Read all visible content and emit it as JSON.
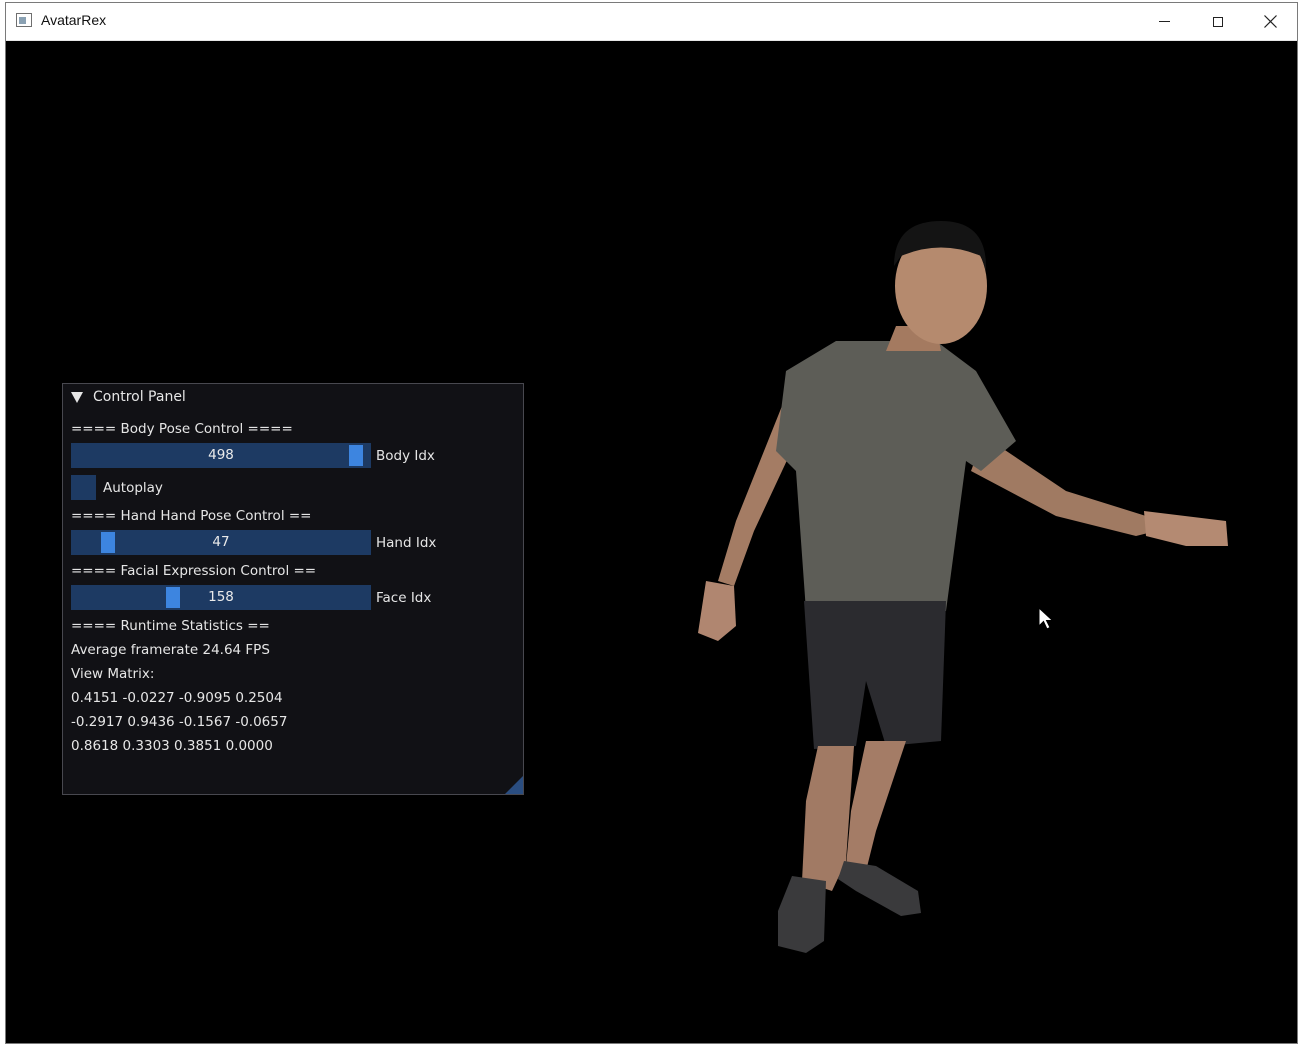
{
  "window": {
    "title": "AvatarRex",
    "minimize": "",
    "maximize": "",
    "close": ""
  },
  "panel": {
    "title": "Control Panel",
    "body_section": "==== Body Pose Control ====",
    "body_slider": {
      "value": "498",
      "label": "Body Idx",
      "fraction": 0.98
    },
    "autoplay": {
      "label": "Autoplay",
      "checked": false
    },
    "hand_section": "==== Hand Hand Pose Control ==",
    "hand_slider": {
      "value": "47",
      "label": "Hand Idx",
      "fraction": 0.1
    },
    "face_section": "==== Facial Expression Control ==",
    "face_slider": {
      "value": "158",
      "label": "Face Idx",
      "fraction": 0.33
    },
    "runtime_section": "==== Runtime Statistics ==",
    "framerate": "Average framerate 24.64 FPS",
    "view_matrix_label": "View Matrix:",
    "matrix_rows": [
      "0.4151 -0.0227 -0.9095 0.2504",
      "-0.2917 0.9436 -0.1567 -0.0657",
      "0.8618 0.3303 0.3851 0.0000"
    ]
  },
  "colors": {
    "slider_bg": "#1d3a63",
    "slider_grab": "#3d85e0",
    "panel_bg": "#121216"
  }
}
